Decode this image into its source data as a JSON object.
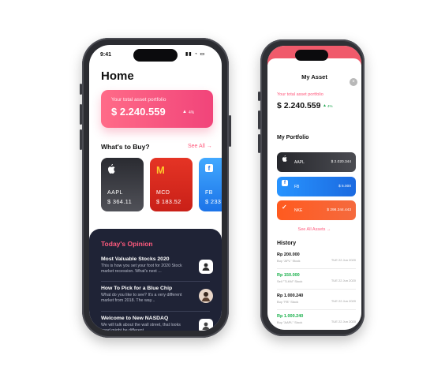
{
  "left_phone": {
    "status_time": "9:41",
    "title": "Home",
    "portfolio": {
      "label": "Your total asset portfolio",
      "value": "$ 2.240.559",
      "change": "4%"
    },
    "section_title": "What's to Buy?",
    "see_all": "See All →",
    "stocks": [
      {
        "icon": "apple-icon",
        "ticker": "AAPL",
        "price": "$ 364.11"
      },
      {
        "icon": "mcdonalds-icon",
        "glyph": "M",
        "ticker": "MCD",
        "price": "$ 183.52"
      },
      {
        "icon": "facebook-icon",
        "glyph": "f",
        "ticker": "FB",
        "price": "$ 233"
      }
    ],
    "opinion": {
      "title": "Today's Opinion",
      "items": [
        {
          "title": "Most Valuable Stocks 2020",
          "desc": "This is how you set your foot for 2020 Stock market recession. What's next ..."
        },
        {
          "title": "How To Pick for a Blue Chip",
          "desc": "What do you like to see? It's a very different market from 2018. The way..."
        },
        {
          "title": "Welcome to New NASDAQ",
          "desc": "We will talk about the wall street, that looks good might be different"
        }
      ]
    }
  },
  "right_phone": {
    "title": "My Asset",
    "close": "×",
    "portfolio": {
      "label": "Your total asset portfolio",
      "value": "$ 2.240.559",
      "change": "4%"
    },
    "my_portfolio_title": "My Portfolio",
    "cards": [
      {
        "icon": "apple-icon",
        "ticker": "AAPL",
        "price": "$ 2.020.344"
      },
      {
        "icon": "facebook-icon",
        "glyph": "f",
        "ticker": "FB",
        "price": "$ 5.000"
      },
      {
        "icon": "nike-icon",
        "glyph": "✓",
        "ticker": "NKE",
        "price": "$ 298.344.443"
      }
    ],
    "see_all": "See All Assets →",
    "history_title": "History",
    "history": [
      {
        "amount": "Rp 200.000",
        "sub": "Buy \"APL\" Stock",
        "date": "TUE 22 Jun 2020",
        "positive": false
      },
      {
        "amount": "Rp 150.000",
        "sub": "Sell \"TLKM\" Stock",
        "date": "TUE 22 Jun 2020",
        "positive": true
      },
      {
        "amount": "Rp 1.000.240",
        "sub": "Buy \"FB\" Stock",
        "date": "TUE 22 Jun 2020",
        "positive": false
      },
      {
        "amount": "Rp 1.000.240",
        "sub": "Buy \"AAPL\" Stock",
        "date": "TUE 22 Jun 2020",
        "positive": true
      }
    ]
  }
}
